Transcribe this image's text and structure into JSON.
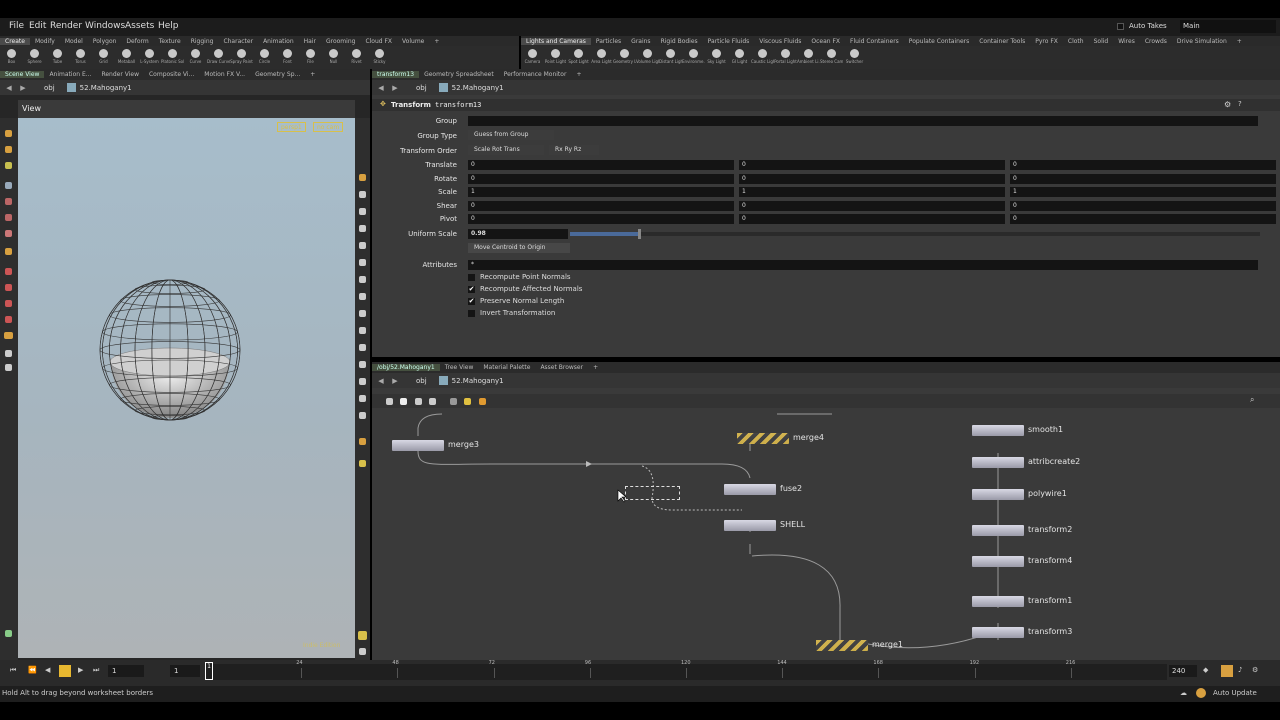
{
  "menu": [
    "File",
    "Edit",
    "Render",
    "Windows",
    "Assets",
    "Help"
  ],
  "auto_takes": "Auto Takes",
  "desktop": "Main",
  "shelf_left_tabs": [
    "Create",
    "Modify",
    "Model",
    "Polygon",
    "Deform",
    "Texture",
    "Rigging",
    "Character",
    "Animation",
    "Hair",
    "Grooming",
    "Cloud FX",
    "Volume"
  ],
  "shelf_left_tools": [
    "Box",
    "Sphere",
    "Tube",
    "Torus",
    "Grid",
    "Metaball",
    "L-System",
    "Platonic Sol...",
    "Curve",
    "Draw Curve",
    "Spray Paint",
    "Circle",
    "Font",
    "File",
    "Null",
    "Rivet",
    "Sticky"
  ],
  "shelf_right_tabs": [
    "Lights and Cameras",
    "Particles",
    "Grains",
    "Rigid Bodies",
    "Particle Fluids",
    "Viscous Fluids",
    "Ocean FX",
    "Fluid Containers",
    "Populate Containers",
    "Container Tools",
    "Pyro FX",
    "Cloth",
    "Solid",
    "Wires",
    "Crowds",
    "Drive Simulation"
  ],
  "shelf_right_tools": [
    "Camera",
    "Point Light",
    "Spot Light",
    "Area Light",
    "Geometry L...",
    "Volume Light",
    "Distant Light",
    "Environme...",
    "Sky Light",
    "GI Light",
    "Caustic Light",
    "Portal Light",
    "Ambient Li...",
    "Stereo Cam...",
    "Switcher"
  ],
  "left_pane_tabs": [
    "Scene View",
    "Animation E...",
    "Render View",
    "Composite Vi...",
    "Motion FX V...",
    "Geometry Sp..."
  ],
  "right_pane_tabs": [
    "transform13",
    "Geometry Spreadsheet",
    "Performance Monitor"
  ],
  "network_tabs": [
    "/obj/52.Mahogany1",
    "Tree View",
    "Material Palette",
    "Asset Browser"
  ],
  "path": {
    "obj": "obj",
    "node": "52.Mahogany1"
  },
  "viewport": {
    "title": "View",
    "camera": "persp1",
    "cam_menu": "no cam"
  },
  "params": {
    "type": "Transform",
    "name": "transform13",
    "group_label": "Group",
    "group_value": "",
    "group_type_label": "Group Type",
    "group_type": "Guess from Group",
    "order_label": "Transform Order",
    "order": "Scale Rot Trans",
    "rot_order": "Rx Ry Rz",
    "rows": [
      {
        "label": "Translate",
        "v": [
          "0",
          "0",
          "0"
        ]
      },
      {
        "label": "Rotate",
        "v": [
          "0",
          "0",
          "0"
        ]
      },
      {
        "label": "Scale",
        "v": [
          "1",
          "1",
          "1"
        ]
      },
      {
        "label": "Shear",
        "v": [
          "0",
          "0",
          "0"
        ]
      },
      {
        "label": "Pivot",
        "v": [
          "0",
          "0",
          "0"
        ]
      }
    ],
    "uniform_label": "Uniform Scale",
    "uniform_value": "0.98",
    "uniform_fraction": 0.98,
    "centroid_button": "Move Centroid to Origin",
    "attrib_label": "Attributes",
    "attrib_value": "*",
    "checks": [
      {
        "label": "Recompute Point Normals",
        "checked": false
      },
      {
        "label": "Recompute Affected Normals",
        "checked": true
      },
      {
        "label": "Preserve Normal Length",
        "checked": true
      },
      {
        "label": "Invert Transformation",
        "checked": false
      }
    ]
  },
  "nodes": [
    "merge3",
    "merge4",
    "fuse2",
    "SHELL",
    "merge1",
    "smooth1",
    "attribcreate2",
    "polywire1",
    "transform2",
    "transform4",
    "transform1",
    "transform3"
  ],
  "timeline": {
    "frame": "1",
    "start": "1",
    "end": "240",
    "ticks": [
      "24",
      "48",
      "72",
      "96",
      "120",
      "144",
      "168",
      "192",
      "216"
    ],
    "current_frame_fraction": 0.0
  },
  "status": {
    "message": "Hold Alt to drag beyond worksheet borders",
    "auto_update": "Auto Update"
  },
  "colors": {
    "accent": "#d8c04a",
    "bg": "#3a3a3a",
    "viewport_top": "#a7bdcb"
  }
}
